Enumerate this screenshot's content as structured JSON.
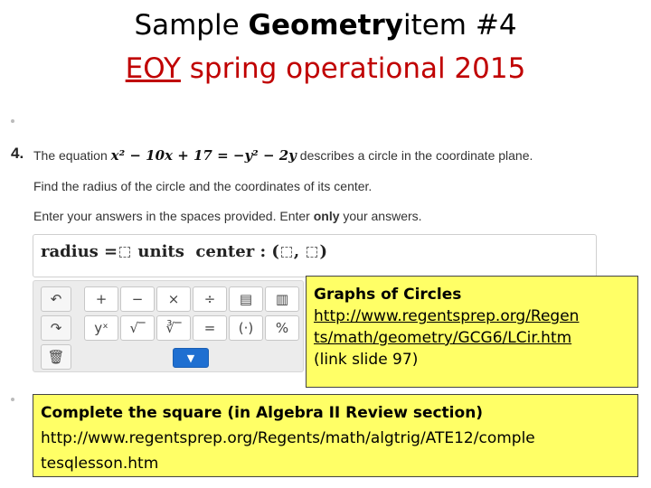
{
  "slide": {
    "title_line1_pre": "Sample ",
    "title_line1_bold": "Geometry",
    "title_line1_post": "item #4",
    "title_line2_underlined": "EOY",
    "title_line2_rest": " spring operational 2015"
  },
  "question": {
    "number": "4.",
    "line1_pre": "The equation ",
    "equation_left": "x² − 10x + 17",
    "equals": " = ",
    "equation_right": "−y² − 2y",
    "line1_post": " describes a circle in the coordinate plane.",
    "line2": "Find the radius of the circle and the coordinates of its center.",
    "line3_pre": "Enter your answers in the spaces provided. Enter ",
    "line3_bold": "only",
    "line3_post": " your answers."
  },
  "answer": {
    "radius_label": "radius =",
    "units_label": " units",
    "center_label": "center : (",
    "comma": ",",
    "close": ")"
  },
  "keypad": {
    "undo": "↶",
    "redo": "↷",
    "trash": "🗑",
    "row1": [
      "+",
      "−",
      "×",
      "÷",
      "▤",
      "▥"
    ],
    "row2": [
      "yˣ",
      "√‾",
      "∛‾",
      "=",
      "(·)",
      "%"
    ],
    "expand": "▼"
  },
  "callout_circles": {
    "heading": "Graphs of Circles",
    "link_line1": "http://www.regentsprep.org/Regen",
    "link_line2": "ts/math/geometry/GCG6/LCir.htm",
    "note": "(link slide 97)"
  },
  "callout_square": {
    "heading": "Complete the square (in Algebra II Review section)",
    "link_line1": "http://www.regentsprep.org/Regents/math/algtrig/ATE12/comple",
    "link_line2": "tesqlesson.htm"
  }
}
